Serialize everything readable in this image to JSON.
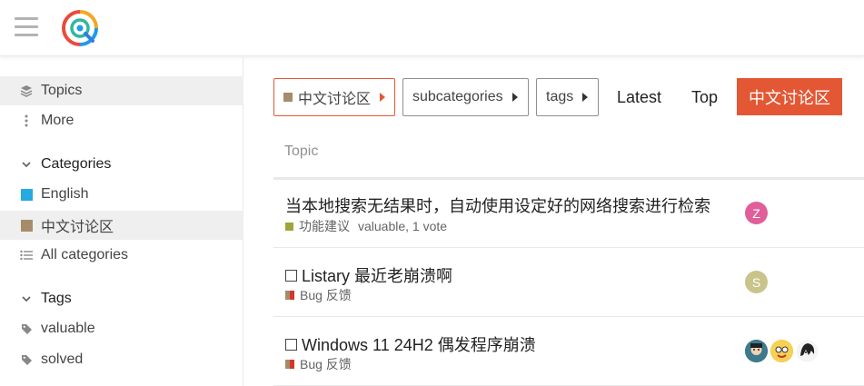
{
  "header": {
    "menu_icon": "hamburger-icon",
    "logo": "listary-logo"
  },
  "sidebar": {
    "topics": "Topics",
    "more": "More",
    "categories_heading": "Categories",
    "english": "English",
    "chinese": "中文讨论区",
    "all_categories": "All categories",
    "tags_heading": "Tags",
    "tag_valuable": "valuable",
    "tag_solved": "solved"
  },
  "nav": {
    "category": "中文讨论区",
    "subcategories": "subcategories",
    "tags": "tags",
    "latest": "Latest",
    "top": "Top",
    "new_button": "中文讨论区"
  },
  "list": {
    "column_topic": "Topic",
    "topics": [
      {
        "title": "当本地搜索无结果时，自动使用设定好的网络搜索进行检索",
        "category": "功能建议",
        "meta": "valuable, 1 vote",
        "avatar": "Z"
      },
      {
        "title": "Listary 最近老崩溃啊",
        "category": "Bug 反馈",
        "avatar": "S"
      },
      {
        "title": "Windows 11 24H2 偶发程序崩溃",
        "category": "Bug 反馈"
      }
    ]
  },
  "colors": {
    "accent": "#e45735",
    "english": "#25aae1",
    "chinese": "#a68c6a",
    "feature": "#9ea53a"
  }
}
